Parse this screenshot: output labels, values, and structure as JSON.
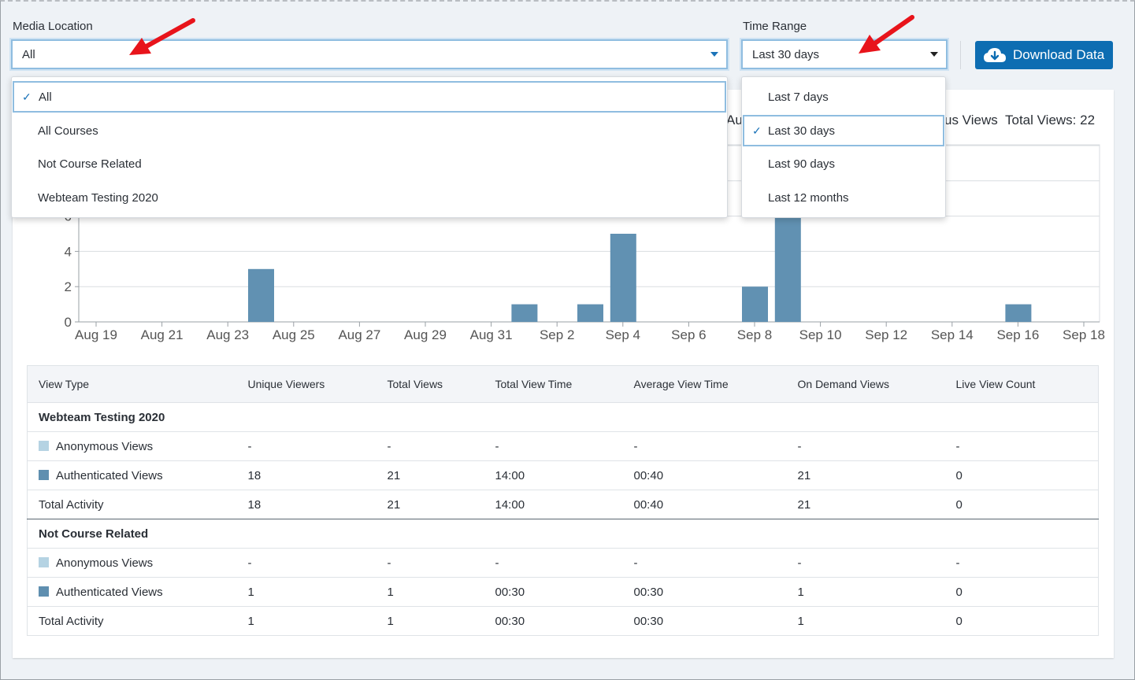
{
  "filters": {
    "media_location": {
      "label": "Media Location",
      "value": "All",
      "options": [
        "All",
        "All Courses",
        "Not Course Related",
        "Webteam Testing 2020"
      ],
      "selected_option": "All"
    },
    "time_range": {
      "label": "Time Range",
      "value": "Last 30 days",
      "options": [
        "Last 7 days",
        "Last 30 days",
        "Last 90 days",
        "Last 12 months"
      ],
      "selected_option": "Last 30 days"
    },
    "download_label": "Download Data"
  },
  "chart_header": {
    "legend_partial_left": "Au",
    "legend_partial_right": "us Views",
    "total_views": "Total Views: 22"
  },
  "colors": {
    "bar": "#6191b2",
    "anonymous_swatch": "#b5d3e3",
    "authenticated_swatch": "#5f8fb0",
    "accent": "#0d6db2",
    "annotation_arrow": "#e8141b"
  },
  "chart_data": {
    "type": "bar",
    "x_tick_labels": [
      "Aug 19",
      "Aug 21",
      "Aug 23",
      "Aug 25",
      "Aug 27",
      "Aug 29",
      "Aug 31",
      "Sep 2",
      "Sep 4",
      "Sep 6",
      "Sep 8",
      "Sep 10",
      "Sep 12",
      "Sep 14",
      "Sep 16",
      "Sep 18"
    ],
    "y_tick_labels": [
      "0",
      "2",
      "4",
      "6"
    ],
    "ylim": [
      0,
      10
    ],
    "grid": true,
    "bars": [
      {
        "date": "Aug 24",
        "value": 3
      },
      {
        "date": "Sep 1",
        "value": 1
      },
      {
        "date": "Sep 3",
        "value": 1
      },
      {
        "date": "Sep 4",
        "value": 5
      },
      {
        "date": "Sep 8",
        "value": 2
      },
      {
        "date": "Sep 9",
        "value": 9
      },
      {
        "date": "Sep 16",
        "value": 1
      }
    ]
  },
  "table": {
    "headers": [
      "View Type",
      "Unique Viewers",
      "Total Views",
      "Total View Time",
      "Average View Time",
      "On Demand Views",
      "Live View Count"
    ],
    "groups": [
      {
        "title": "Webteam Testing 2020",
        "rows": [
          {
            "type": "Anonymous Views",
            "swatch": "anonymous",
            "cells": [
              "-",
              "-",
              "-",
              "-",
              "-",
              "-"
            ]
          },
          {
            "type": "Authenticated Views",
            "swatch": "authenticated",
            "cells": [
              "18",
              "21",
              "14:00",
              "00:40",
              "21",
              "0"
            ]
          },
          {
            "type": "Total Activity",
            "swatch": "",
            "cells": [
              "18",
              "21",
              "14:00",
              "00:40",
              "21",
              "0"
            ]
          }
        ]
      },
      {
        "title": "Not Course Related",
        "rows": [
          {
            "type": "Anonymous Views",
            "swatch": "anonymous",
            "cells": [
              "-",
              "-",
              "-",
              "-",
              "-",
              "-"
            ]
          },
          {
            "type": "Authenticated Views",
            "swatch": "authenticated",
            "cells": [
              "1",
              "1",
              "00:30",
              "00:30",
              "1",
              "0"
            ]
          },
          {
            "type": "Total Activity",
            "swatch": "",
            "cells": [
              "1",
              "1",
              "00:30",
              "00:30",
              "1",
              "0"
            ]
          }
        ]
      }
    ]
  }
}
